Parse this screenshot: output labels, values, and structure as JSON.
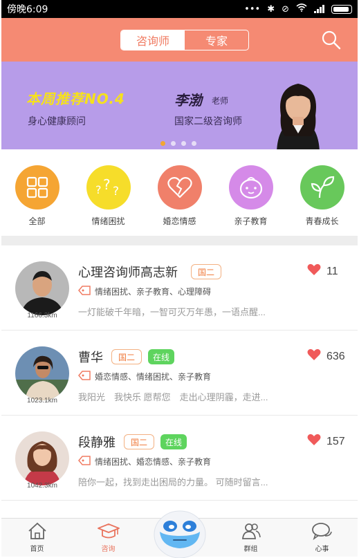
{
  "status_bar": {
    "time": "傍晚6:09",
    "icons": [
      "more-dots-icon",
      "bluetooth-icon",
      "mute-icon",
      "wifi-icon",
      "signal-icon",
      "battery-icon"
    ]
  },
  "header": {
    "tabs": [
      "咨询师",
      "专家"
    ],
    "active_tab": "咨询师",
    "search_icon": "search-icon"
  },
  "banner": {
    "title": "本周推荐NO.4",
    "subtitle": "身心健康顾问",
    "counselor_name": "李渤",
    "counselor_role": "老师",
    "counselor_desc": "国家二级咨询师",
    "page_count": 4,
    "active_page": 1
  },
  "categories": [
    {
      "label": "全部",
      "icon": "grid-icon",
      "color": "#f5a533"
    },
    {
      "label": "情绪困扰",
      "icon": "question-marks-icon",
      "color": "#f6dd2a"
    },
    {
      "label": "婚恋情感",
      "icon": "broken-heart-icon",
      "color": "#f0806a"
    },
    {
      "label": "亲子教育",
      "icon": "baby-face-icon",
      "color": "#d58ae8"
    },
    {
      "label": "青春成长",
      "icon": "sprout-icon",
      "color": "#68c85b"
    }
  ],
  "counselors": [
    {
      "name": "心理咨询师高志新",
      "rank": "国二",
      "online": "",
      "likes": "11",
      "tags": "情绪困扰、亲子教育、心理障碍",
      "desc": "一灯能破千年暗，一智可灭万年愚，一语点醒...",
      "distance": "1166.3km"
    },
    {
      "name": "曹华",
      "rank": "国二",
      "online": "在线",
      "likes": "636",
      "tags": "婚恋情感、情绪困扰、亲子教育",
      "desc": "我阳光　我快乐 愿帮您　走出心理阴霾，走进...",
      "distance": "1023.1km"
    },
    {
      "name": "段静雅",
      "rank": "国二",
      "online": "在线",
      "likes": "157",
      "tags": "情绪困扰、婚恋情感、亲子教育",
      "desc": "陪你一起，找到走出困局的力量。 可随时留言...",
      "distance": "1042.3km"
    }
  ],
  "tabbar": [
    {
      "label": "首页",
      "icon": "home-icon"
    },
    {
      "label": "咨询",
      "icon": "graduation-cap-icon",
      "active": true
    },
    {
      "label": "群组",
      "icon": "group-icon"
    },
    {
      "label": "心事",
      "icon": "chat-bubbles-icon"
    }
  ],
  "accent_color": "#f58a73"
}
